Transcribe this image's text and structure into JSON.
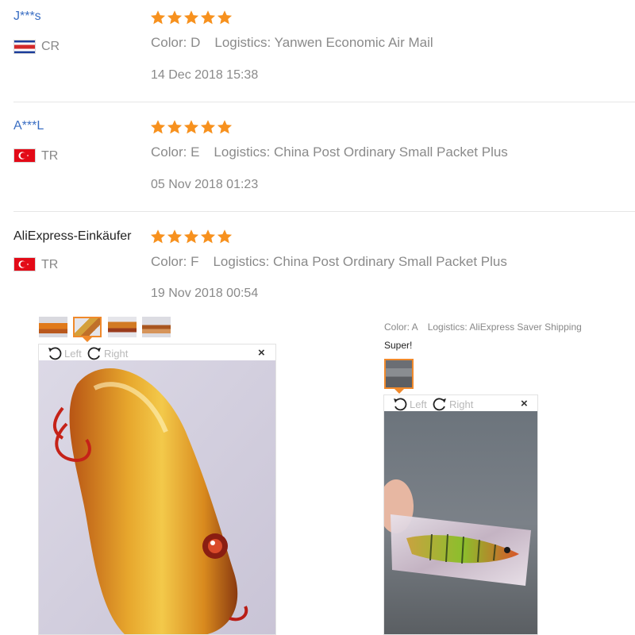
{
  "reviews": [
    {
      "user": "J***s",
      "country_code": "CR",
      "flag": "costa-rica-flag",
      "rating": 5,
      "color_label": "Color: D",
      "logistics_label": "Logistics: Yanwen Economic Air Mail",
      "date": "14 Dec 2018 15:38"
    },
    {
      "user": "A***L",
      "country_code": "TR",
      "flag": "turkey-flag",
      "rating": 5,
      "color_label": "Color: E",
      "logistics_label": "Logistics: China Post Ordinary Small Packet Plus",
      "date": "05 Nov 2018 01:23"
    },
    {
      "user": "AliExpress-Einkäufer",
      "country_code": "TR",
      "flag": "turkey-flag",
      "rating": 5,
      "color_label": "Color: F",
      "logistics_label": "Logistics: China Post Ordinary Small Packet Plus",
      "date": "19 Nov 2018 00:54"
    }
  ],
  "left_viewer": {
    "rotate_left_label": "Left",
    "rotate_right_label": "Right",
    "close_glyph": "×",
    "thumbnail_count": 4,
    "selected_thumbnail": 2
  },
  "right_review": {
    "color_label": "Color: A",
    "logistics_label": "Logistics: AliExpress Saver Shipping",
    "comment": "Super!",
    "rotate_left_label": "Left",
    "rotate_right_label": "Right",
    "close_glyph": "×"
  },
  "colors": {
    "star": "#f7911e",
    "user_link": "#3a6ec3",
    "meta_text": "#8a8a8a",
    "selected_border": "#f0892b"
  }
}
